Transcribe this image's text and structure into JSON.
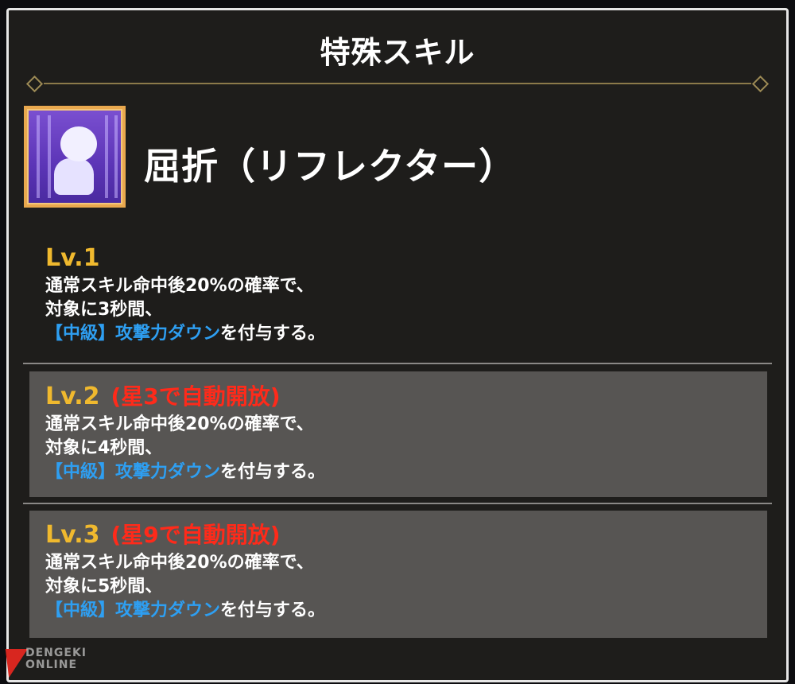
{
  "panel": {
    "title": "特殊スキル"
  },
  "skill": {
    "icon": "ghost-prisoner-icon",
    "name": "屈折（リフレクター）"
  },
  "levels": [
    {
      "label": "Lv.1",
      "unlock": "",
      "line1": "通常スキル命中後20%の確率で、",
      "line2": "対象に3秒間、",
      "effect": "【中級】攻撃力ダウン",
      "suffix": "を付与する。"
    },
    {
      "label": "Lv.2",
      "unlock": "(星3で自動開放)",
      "line1": "通常スキル命中後20%の確率で、",
      "line2": "対象に4秒間、",
      "effect": "【中級】攻撃力ダウン",
      "suffix": "を付与する。"
    },
    {
      "label": "Lv.3",
      "unlock": "(星9で自動開放)",
      "line1": "通常スキル命中後20%の確率で、",
      "line2": "対象に5秒間、",
      "effect": "【中級】攻撃力ダウン",
      "suffix": "を付与する。"
    }
  ],
  "watermark": {
    "line1": "DENGEKI",
    "line2": "ONLINE"
  },
  "colors": {
    "level_label": "#f0b92e",
    "unlock": "#ff2a1a",
    "effect": "#2e9ff2",
    "text": "#ffffff",
    "locked_box": "#575553"
  }
}
